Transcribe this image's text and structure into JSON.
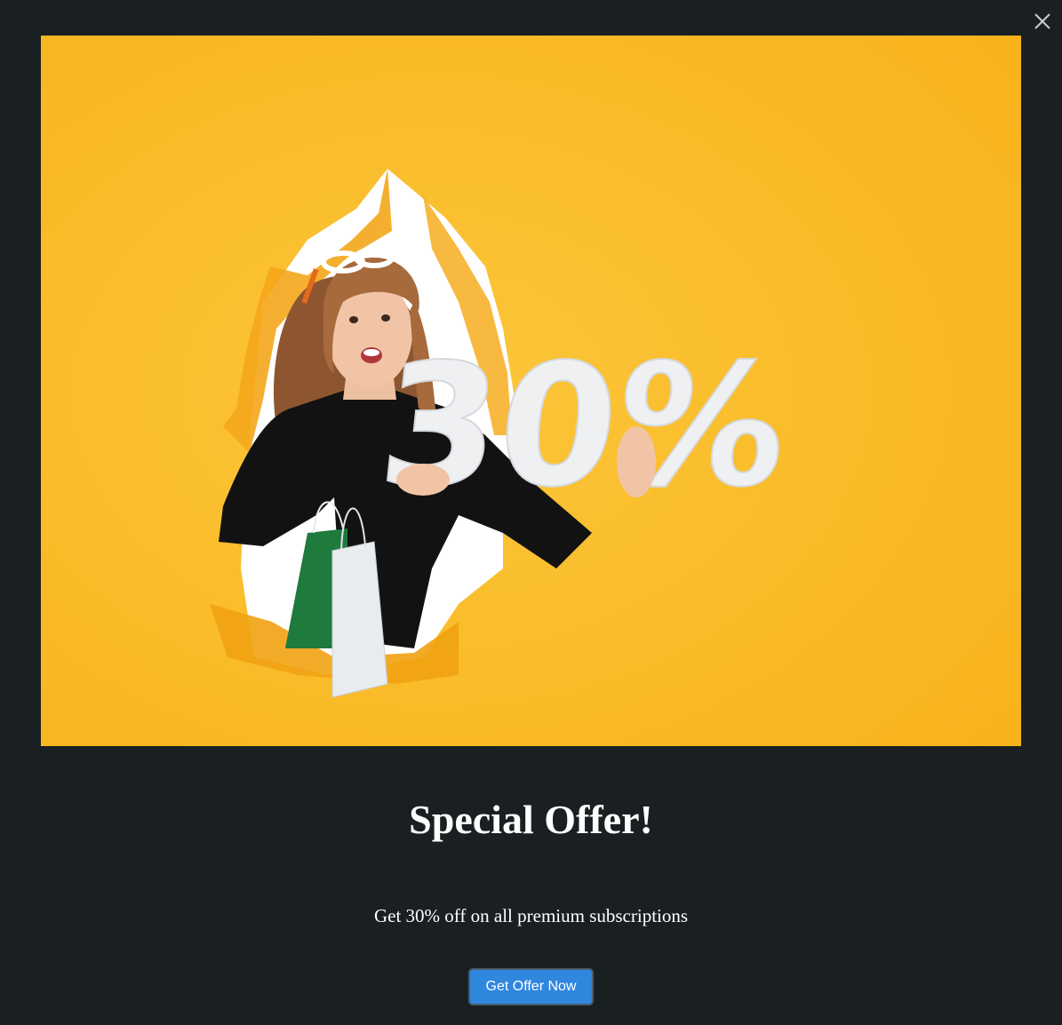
{
  "modal": {
    "close_icon": "close-icon",
    "hero_image": {
      "description_icon": "promo-photo",
      "overlay_text": "30%",
      "colors": {
        "background": "#f9b81f",
        "hole": "#ffffff",
        "sweater": "#121212",
        "hair": "#a66a3c",
        "skin": "#f1c4a6",
        "bag_green": "#1f7a3d",
        "bag_white": "#e8ecef"
      }
    },
    "title": "Special Offer!",
    "subtitle": "Get 30% off on all premium subscriptions",
    "cta_label": "Get Offer Now"
  },
  "colors": {
    "page_background": "#1a2021",
    "button_background": "#2f87de",
    "button_border": "#4b5b6b",
    "text": "#ffffff"
  }
}
